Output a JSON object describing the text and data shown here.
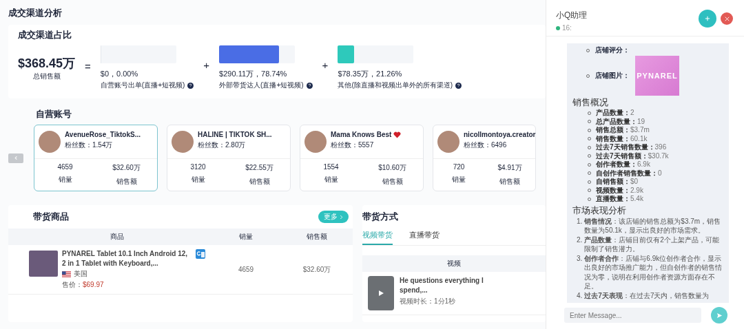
{
  "page_title": "成交渠道分析",
  "channel_share": {
    "title": "成交渠道占比",
    "total": {
      "value": "$368.45万",
      "label": "总销售额"
    },
    "equals": "=",
    "plus": "+",
    "channels": [
      {
        "value": "$0，0.00%",
        "label": "自营账号出单(直播+短视频)",
        "level": 0
      },
      {
        "value": "$290.11万，78.74%",
        "label": "外部带货达人(直播+短视频)",
        "level": 0.7874,
        "color": "#4a6de5"
      },
      {
        "value": "$78.35万，21.26%",
        "label": "其他(除直播和视频出单外的所有渠道)",
        "level": 0.2126,
        "color": "#2ec9bb"
      }
    ]
  },
  "own_accounts": {
    "title": "自营账号",
    "accounts": [
      {
        "name": "AvenueRose_TiktokS...",
        "heart": false,
        "fans": "粉丝数：1.54万",
        "sales_count": "4659",
        "sales_amount": "$32.60万",
        "count_label": "销量",
        "amount_label": "销售额",
        "selected": true
      },
      {
        "name": "HALINE | TIKTOK SH...",
        "heart": false,
        "fans": "粉丝数：2.80万",
        "sales_count": "3120",
        "sales_amount": "$22.55万",
        "count_label": "销量",
        "amount_label": "销售额",
        "selected": false
      },
      {
        "name": "Mama Knows Best",
        "heart": true,
        "fans": "粉丝数：5557",
        "sales_count": "1554",
        "sales_amount": "$10.60万",
        "count_label": "销量",
        "amount_label": "销售额",
        "selected": false
      },
      {
        "name": "nicollmontoya.creator",
        "heart": false,
        "fans": "粉丝数：6496",
        "sales_count": "720",
        "sales_amount": "$4.91万",
        "count_label": "销量",
        "amount_label": "销售额",
        "selected": false
      }
    ]
  },
  "products": {
    "title": "带货商品",
    "more": "更多",
    "columns": [
      "商品",
      "销量",
      "销售额"
    ],
    "rows": [
      {
        "title": "PYNAREL Tablet 10.1 Inch Android 12, 2 in 1 Tablet with Keyboard,...",
        "country": "美国",
        "price_label": "售价：",
        "price": "$69.97",
        "sales_count": "4659",
        "sales_amount": "$32.60万"
      }
    ]
  },
  "methods": {
    "title": "带货方式",
    "tabs": [
      {
        "label": "视频带货",
        "selected": true
      },
      {
        "label": "直播带货",
        "selected": false
      }
    ],
    "column": "视频",
    "rows": [
      {
        "title": "He questions everything I spend,...",
        "duration": "视频时长：1分1秒"
      }
    ]
  },
  "assistant": {
    "title": "小Q助理",
    "time": "16:",
    "store_items": [
      {
        "kind": "text",
        "label": "店铺评分："
      },
      {
        "kind": "image",
        "label": "店铺图片：",
        "logo": "PYNAREL"
      }
    ],
    "sections": [
      {
        "kind": "bullets",
        "heading": "销售概况",
        "items": [
          {
            "label": "产品数量：",
            "value": "2"
          },
          {
            "label": "总产品数量：",
            "value": "19"
          },
          {
            "label": "销售总额：",
            "value": "$3.7m"
          },
          {
            "label": "销售数量：",
            "value": "60.1k"
          },
          {
            "label": "过去7天销售数量：",
            "value": "396"
          },
          {
            "label": "过去7天销售额：",
            "value": "$30.7k"
          },
          {
            "label": "创作者数量：",
            "value": "6.9k"
          },
          {
            "label": "自创作者销售数量：",
            "value": "0"
          },
          {
            "label": "自销售额：",
            "value": "$0"
          },
          {
            "label": "视频数量：",
            "value": "2.9k"
          },
          {
            "label": "直播数量：",
            "value": "5.4k"
          }
        ]
      },
      {
        "kind": "numbered",
        "heading": "市场表现分析",
        "items": [
          {
            "number": "1.",
            "text": "**销售情况**：该店铺的销售总额为$3.7m，销售数量为50.1k，显示出良好的市场需求。"
          },
          {
            "number": "2.",
            "text": "**产品数量**：店铺目前仅有2个上架产品，可能限制了销售潜力。"
          },
          {
            "number": "3.",
            "text": "**创作者合作**：店铺与6.9k位创作者合作，显示出良好的市场推广能力，但自创作者的销售情况为零，说明在利用创作者资源方面存在不足。"
          },
          {
            "number": "4.",
            "text": "**过去7天表现**：在过去7天内，销售数量为"
          }
        ]
      }
    ],
    "input": {
      "placeholder": "Enter Message..."
    }
  }
}
